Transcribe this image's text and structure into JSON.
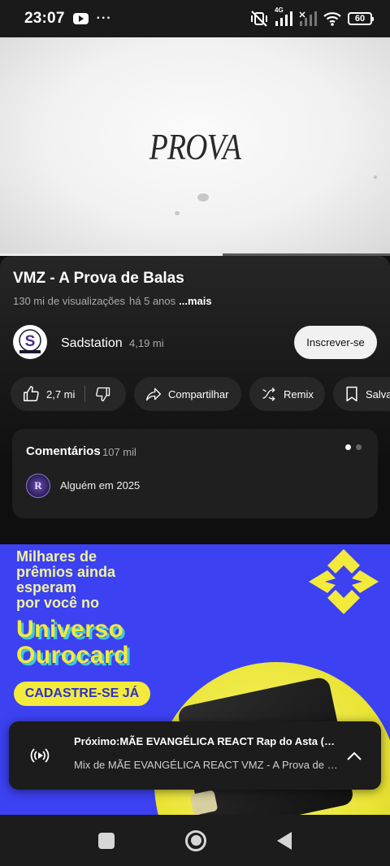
{
  "status_bar": {
    "time": "23:07",
    "dots": "···",
    "network": "4G",
    "battery": "60"
  },
  "video": {
    "frame_text": "PROVA",
    "progress_fraction": 0.57
  },
  "info": {
    "title": "VMZ - A Prova de Balas",
    "views": "130 mi de visualizações",
    "age": "há 5 anos",
    "more": "...mais"
  },
  "channel": {
    "name": "Sadstation",
    "subscribers": "4,19 mi",
    "subscribe_label": "Inscrever-se"
  },
  "actions": {
    "likes": "2,7 mi",
    "share": "Compartilhar",
    "remix": "Remix",
    "save": "Salvar"
  },
  "comments": {
    "title": "Comentários",
    "count": "107 mil",
    "avatar_letter": "R",
    "preview": "Alguém em 2025"
  },
  "ad": {
    "line1": "Milhares de",
    "line2": "prêmios ainda",
    "line3": "esperam",
    "line4": "por você no",
    "big1": "Universo",
    "big2": "Ourocard",
    "cta": "CADASTRE-SE JÁ"
  },
  "next_up": {
    "line1": "Próximo:MÃE EVANGÉLICA REACT Rap do Asta (Black Clover)",
    "line2": "Mix de MÃE EVANGÉLICA REACT VMZ - A Prova de Balas e mais"
  },
  "colors": {
    "background": "#0f0f0f",
    "ad_blue": "#3c41f2",
    "ad_yellow": "#f3ea3b"
  }
}
